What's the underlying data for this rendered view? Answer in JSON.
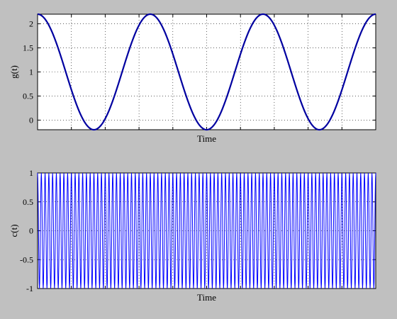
{
  "chart_data": [
    {
      "type": "line",
      "xlabel": "Time",
      "ylabel": "g(t)",
      "ylim": [
        -0.2,
        2.2
      ],
      "yticks": [
        0,
        0.5,
        1,
        1.5,
        2
      ],
      "ytick_labels": [
        "0",
        "0.5",
        "1",
        "1.5",
        "2"
      ],
      "xlim": [
        0,
        3
      ],
      "x_tick_count": 10,
      "x_tick_labels_shown": false,
      "grid": true,
      "series": [
        {
          "color": "#0000a0",
          "function": "1 + 1.2*cos(2*pi*t)",
          "x": [
            0,
            0.25,
            0.5,
            0.75,
            1,
            1.25,
            1.5,
            1.75,
            2,
            2.25,
            2.5,
            2.75,
            3
          ],
          "values": [
            2.2,
            1.0,
            -0.2,
            1.0,
            2.2,
            1.0,
            -0.2,
            1.0,
            2.2,
            1.0,
            -0.2,
            1.0,
            2.2
          ]
        }
      ]
    },
    {
      "type": "line",
      "xlabel": "Time",
      "ylabel": "c(t)",
      "ylim": [
        -1,
        1
      ],
      "yticks": [
        -1,
        -0.5,
        0,
        0.5,
        1
      ],
      "ytick_labels": [
        "-1",
        "-0.5",
        "0",
        "0.5",
        "1"
      ],
      "xlim": [
        0,
        3
      ],
      "x_tick_count": 10,
      "x_tick_labels_shown": false,
      "grid": true,
      "series": [
        {
          "color": "#0000ff",
          "function": "cos(2*pi*30*t)",
          "cycles": 90,
          "amplitude": 1
        }
      ]
    }
  ]
}
